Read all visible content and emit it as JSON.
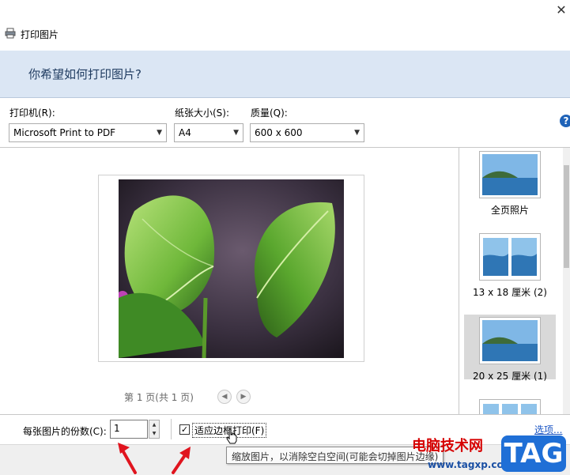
{
  "window": {
    "close_glyph": "✕",
    "title": "打印图片",
    "title_icon": "printer-icon"
  },
  "header": {
    "question": "你希望如何打印图片?"
  },
  "options": {
    "printer": {
      "label": "打印机(R):",
      "value": "Microsoft Print to PDF"
    },
    "paper_size": {
      "label": "纸张大小(S):",
      "value": "A4"
    },
    "quality": {
      "label": "质量(Q):",
      "value": "600 x 600"
    },
    "help_glyph": "?"
  },
  "preview": {
    "page_info": "第 1 页(共 1 页)",
    "prev_icon": "triangle-left-icon",
    "next_icon": "triangle-right-icon"
  },
  "layouts": {
    "items": [
      {
        "caption": "全页照片",
        "selected": false
      },
      {
        "caption": "13 x 18 厘米 (2)",
        "selected": false
      },
      {
        "caption": "20 x 25 厘米 (1)",
        "selected": true
      },
      {
        "caption": "",
        "selected": false
      }
    ]
  },
  "bottom": {
    "copies_label": "每张图片的份数(C):",
    "copies_value": "1",
    "fit_label": "适应边框打印(F)",
    "fit_checked": true,
    "options_link": "选项...",
    "tooltip": "缩放图片，以消除空白空间(可能会切掉图片边缘)"
  },
  "watermark": {
    "site_name": "电脑技术网",
    "url": "www.tagxp.com",
    "logo": "TAG"
  },
  "colors": {
    "header_band": "#dbe6f4",
    "link": "#1a55c4",
    "annotation_arrow": "#e0141e",
    "logo_blue": "#1f6fd6"
  }
}
